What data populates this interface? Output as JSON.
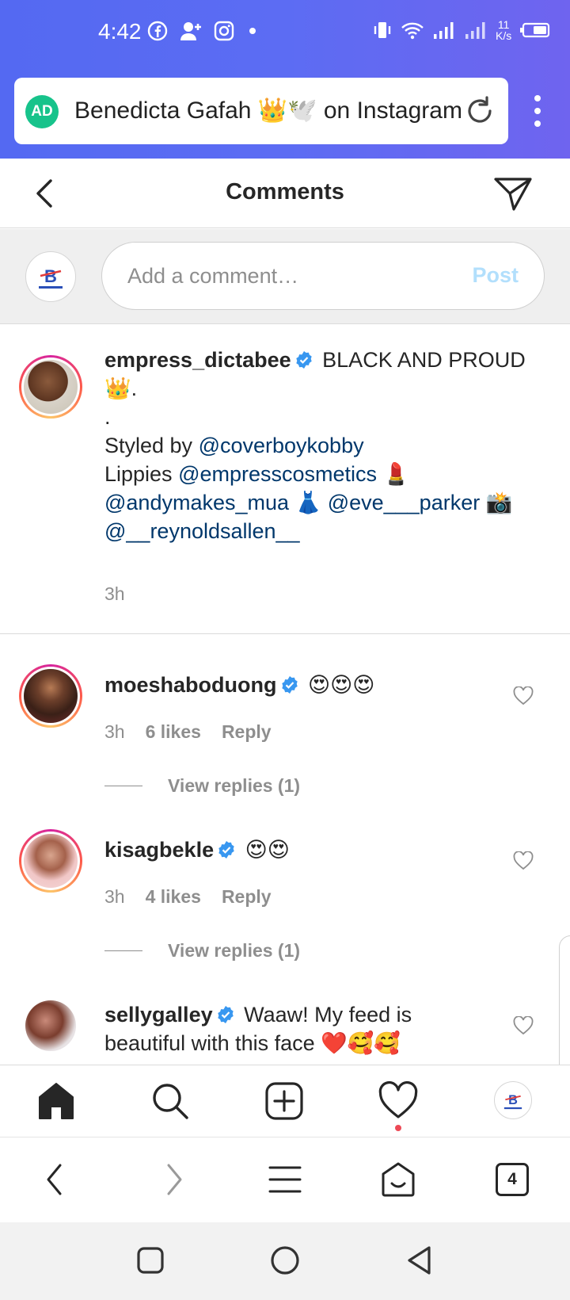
{
  "status_bar": {
    "time": "4:42",
    "net_speed_value": "11",
    "net_speed_unit": "K/s"
  },
  "browser": {
    "ad_badge": "AD",
    "url_text": "Benedicta Gafah 👑🕊️ on Instagram",
    "tabs_count": "4"
  },
  "header": {
    "title": "Comments"
  },
  "add_comment": {
    "placeholder": "Add a comment…",
    "post_label": "Post"
  },
  "caption": {
    "username": "empress_dictabee",
    "text_line1": "BLACK AND PROUD",
    "text_line2": "👑.",
    "text_line3": ".",
    "styled_by_label": "Styled by",
    "mention_stylist": "@coverboykobby",
    "lippies_label": "Lippies",
    "mention_cosmetics": "@empresscosmetics",
    "lipstick_emoji": "💄",
    "mention_mua": "@andymakes_mua",
    "dress_emoji": "👗",
    "mention_parker": "@eve___parker",
    "camera_emoji": "📸",
    "mention_reynold": "@__reynoldsallen__",
    "time": "3h"
  },
  "comments": [
    {
      "username": "moeshaboduong",
      "text": "😍😍😍",
      "time": "3h",
      "likes": "6 likes",
      "reply": "Reply",
      "view_replies": "View replies (1)"
    },
    {
      "username": "kisagbekle",
      "text": "😍😍",
      "time": "3h",
      "likes": "4 likes",
      "reply": "Reply",
      "view_replies": "View replies (1)"
    },
    {
      "username": "sellygalley",
      "text_line1": "Waaw! My feed is",
      "text_line2": "beautiful with this face ❤️🥰🥰"
    }
  ],
  "colors": {
    "chrome_gradient_start": "#5469f2",
    "chrome_gradient_end": "#6f64ef",
    "verified_blue": "#3897f0",
    "mention_blue": "#00376b",
    "post_disabled": "#b2dffc",
    "notification_dot": "#ed4956"
  }
}
